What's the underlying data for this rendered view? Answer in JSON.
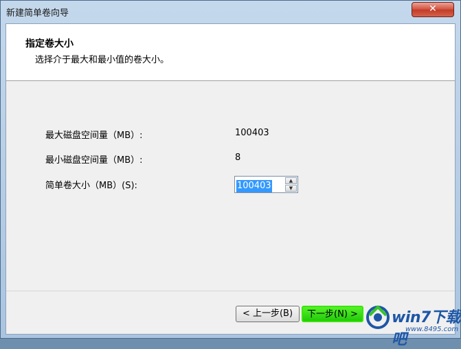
{
  "window": {
    "title": "新建简单卷向导",
    "close_glyph": "✕"
  },
  "header": {
    "title": "指定卷大小",
    "subtitle": "选择介于最大和最小值的卷大小。"
  },
  "fields": [
    {
      "label": "最大磁盘空间量（MB）:",
      "value": "100403"
    },
    {
      "label": "最小磁盘空间量（MB）:",
      "value": "8"
    }
  ],
  "size_field": {
    "label": "简单卷大小（MB）(S):",
    "value": "100403",
    "up_glyph": "▲",
    "down_glyph": "▼"
  },
  "buttons": {
    "back": "< 上一步(B)",
    "next": "下一步(N) >"
  },
  "watermark": {
    "brand": "win7下载吧",
    "url": "www.8495.com"
  },
  "colors": {
    "selection": "#3399ff",
    "next_highlight": "#39e600",
    "watermark": "#1e56a6"
  }
}
